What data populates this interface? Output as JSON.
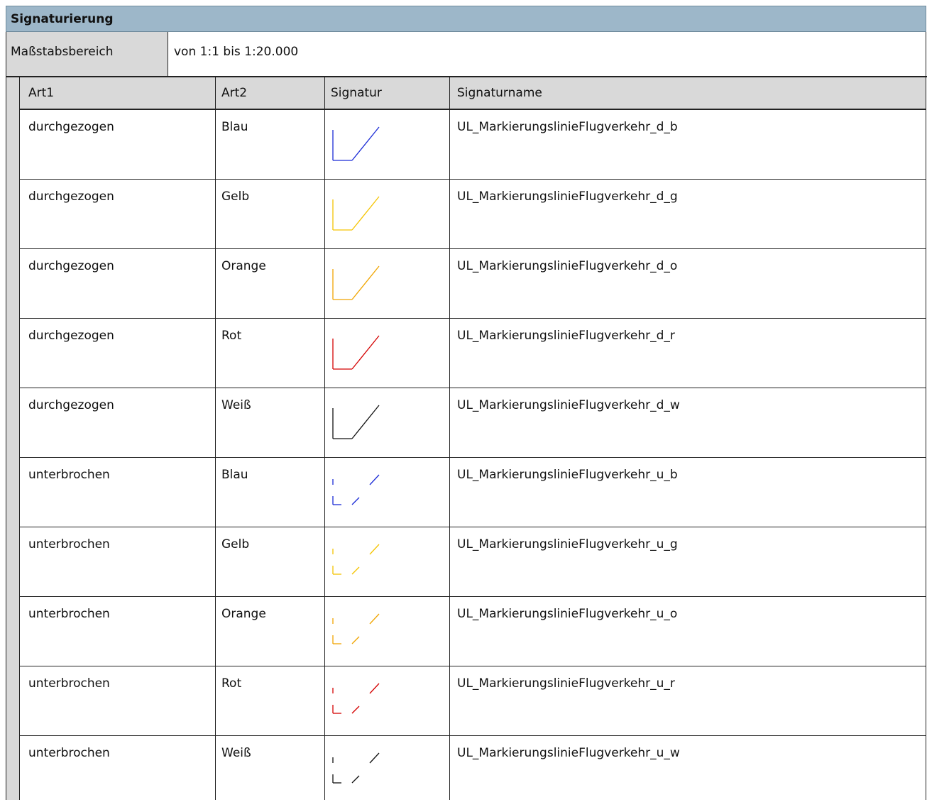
{
  "section_title": "Signaturierung",
  "scale": {
    "label": "Maßstabsbereich",
    "value": "von 1:1 bis 1:20.000"
  },
  "columns": [
    "Art1",
    "Art2",
    "Signatur",
    "Signaturname"
  ],
  "colors": {
    "blau": "#1a2bd6",
    "gelb": "#f5c400",
    "orange": "#f0a500",
    "rot": "#d40000",
    "weiss": "#111111"
  },
  "rows": [
    {
      "art1": "durchgezogen",
      "art2": "Blau",
      "style": "solid",
      "color": "#1a2bd6",
      "name": "UL_MarkierungslinieFlugverkehr_d_b"
    },
    {
      "art1": "durchgezogen",
      "art2": "Gelb",
      "style": "solid",
      "color": "#f5c400",
      "name": "UL_MarkierungslinieFlugverkehr_d_g"
    },
    {
      "art1": "durchgezogen",
      "art2": "Orange",
      "style": "solid",
      "color": "#f0a500",
      "name": "UL_MarkierungslinieFlugverkehr_d_o"
    },
    {
      "art1": "durchgezogen",
      "art2": "Rot",
      "style": "solid",
      "color": "#d40000",
      "name": "UL_MarkierungslinieFlugverkehr_d_r"
    },
    {
      "art1": "durchgezogen",
      "art2": "Weiß",
      "style": "solid",
      "color": "#111111",
      "name": "UL_MarkierungslinieFlugverkehr_d_w"
    },
    {
      "art1": "unterbrochen",
      "art2": "Blau",
      "style": "dashed",
      "color": "#1a2bd6",
      "name": "UL_MarkierungslinieFlugverkehr_u_b"
    },
    {
      "art1": "unterbrochen",
      "art2": "Gelb",
      "style": "dashed",
      "color": "#f5c400",
      "name": "UL_MarkierungslinieFlugverkehr_u_g"
    },
    {
      "art1": "unterbrochen",
      "art2": "Orange",
      "style": "dashed",
      "color": "#f0a500",
      "name": "UL_MarkierungslinieFlugverkehr_u_o"
    },
    {
      "art1": "unterbrochen",
      "art2": "Rot",
      "style": "dashed",
      "color": "#d40000",
      "name": "UL_MarkierungslinieFlugverkehr_u_r"
    },
    {
      "art1": "unterbrochen",
      "art2": "Weiß",
      "style": "dashed",
      "color": "#111111",
      "name": "UL_MarkierungslinieFlugverkehr_u_w"
    }
  ]
}
